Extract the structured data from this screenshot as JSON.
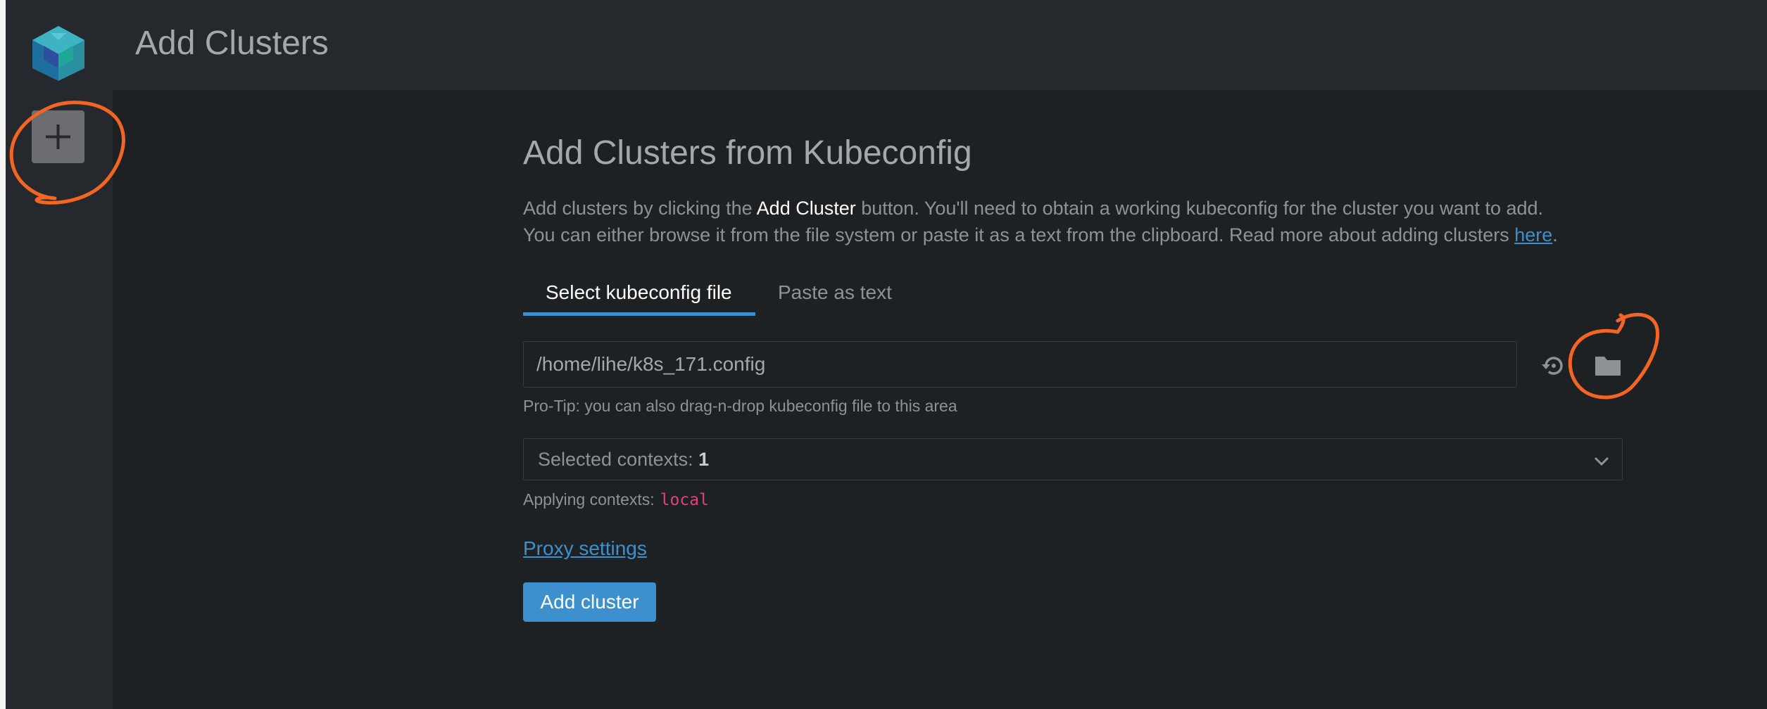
{
  "header": {
    "title": "Add Clusters"
  },
  "sidebar": {
    "add_button_icon": "plus-icon",
    "logo_icon": "lens-cube-logo"
  },
  "form": {
    "title": "Add Clusters from Kubeconfig",
    "description_line1_pre": "Add clusters by clicking the ",
    "description_line1_strong": "Add Cluster",
    "description_line1_post": " button. You'll need to obtain a working kubeconfig for the cluster you want to add.",
    "description_line2_pre": "You can either browse it from the file system or paste it as a text from the clipboard. Read more about adding clusters ",
    "description_line2_link": "here",
    "description_line2_post": ".",
    "tabs": [
      {
        "label": "Select kubeconfig file",
        "active": true
      },
      {
        "label": "Paste as text",
        "active": false
      }
    ],
    "path_value": "/home/lihe/k8s_171.config",
    "reset_icon": "history-reset-icon",
    "browse_icon": "folder-icon",
    "protip": "Pro-Tip: you can also drag-n-drop kubeconfig file to this area",
    "contexts_label": "Selected contexts: ",
    "contexts_count": "1",
    "applying_label": "Applying contexts:",
    "applying_value": "local",
    "proxy_link": "Proxy settings",
    "submit_label": "Add cluster"
  },
  "colors": {
    "accent": "#3d90ce",
    "sidebar_bg": "#25282c",
    "content_bg": "#1e2124",
    "context_value": "#e0417a",
    "annotation": "#f26522"
  }
}
